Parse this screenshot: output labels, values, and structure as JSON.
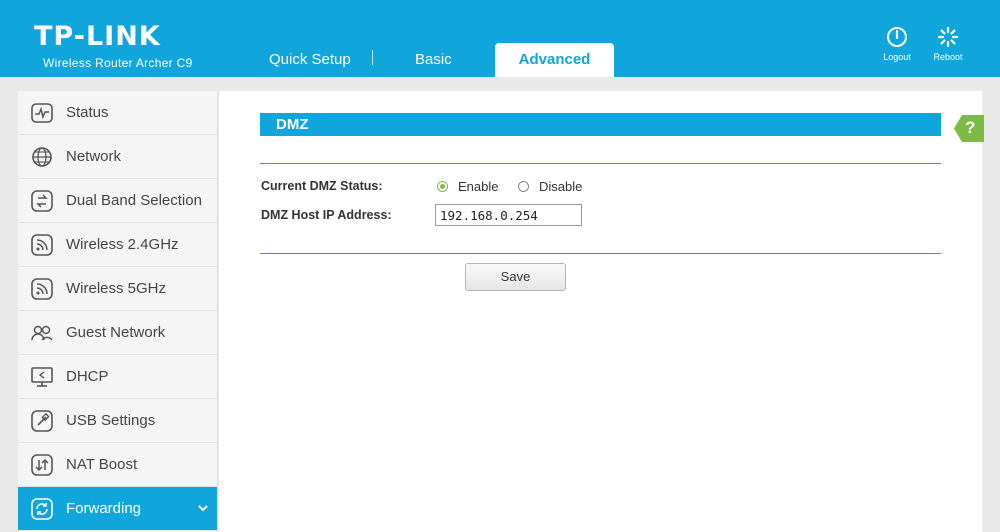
{
  "brand": {
    "logo": "TP-LINK",
    "model": "Wireless Router Archer C9"
  },
  "nav": {
    "tabs": [
      {
        "label": "Quick Setup"
      },
      {
        "label": "Basic"
      },
      {
        "label": "Advanced",
        "active": true
      }
    ]
  },
  "header_actions": {
    "logout_label": "Logout",
    "reboot_label": "Reboot"
  },
  "sidebar": {
    "items": [
      {
        "label": "Status",
        "icon": "status-icon"
      },
      {
        "label": "Network",
        "icon": "globe-icon"
      },
      {
        "label": "Dual Band Selection",
        "icon": "dual-band-icon"
      },
      {
        "label": "Wireless 2.4GHz",
        "icon": "wireless-icon"
      },
      {
        "label": "Wireless 5GHz",
        "icon": "wireless-icon"
      },
      {
        "label": "Guest Network",
        "icon": "guest-icon"
      },
      {
        "label": "DHCP",
        "icon": "monitor-icon"
      },
      {
        "label": "USB Settings",
        "icon": "usb-icon"
      },
      {
        "label": "NAT Boost",
        "icon": "nat-icon"
      },
      {
        "label": "Forwarding",
        "icon": "forwarding-icon",
        "active": true
      }
    ]
  },
  "dmz": {
    "section_title": "DMZ",
    "status_label": "Current DMZ Status:",
    "enable_label": "Enable",
    "disable_label": "Disable",
    "selected": "Enable",
    "host_ip_label": "DMZ Host IP Address:",
    "host_ip_value": "192.168.0.254",
    "save_label": "Save"
  },
  "help_label": "?",
  "colors": {
    "accent": "#10a6dc",
    "radio_selected": "#7dbb46",
    "help_flag": "#7dbb46"
  }
}
